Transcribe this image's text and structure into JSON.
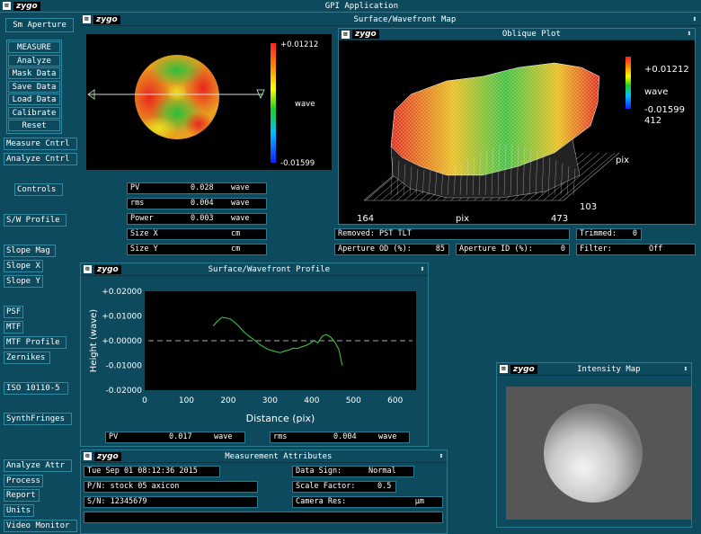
{
  "app": {
    "title": "GPI Application",
    "logo": "zygo"
  },
  "sidebar": {
    "aperture": "Sm Aperture",
    "group1": [
      "MEASURE",
      "Analyze",
      "Mask Data",
      "Save Data",
      "Load Data",
      "Calibrate",
      "Reset"
    ],
    "items": [
      "Measure Cntrl",
      "Analyze Cntrl",
      "Controls",
      "S/W Profile",
      "Slope Mag",
      "Slope X",
      "Slope Y",
      "PSF",
      "MTF",
      "MTF Profile",
      "Zernikes",
      "ISO 10110-5",
      "SynthFringes",
      "Analyze Attr",
      "Process",
      "Report",
      "Units",
      "Video Monitor"
    ]
  },
  "surface_map": {
    "title": "Surface/Wavefront Map",
    "scale_max": "+0.01212",
    "scale_mid": "wave",
    "scale_min": "-0.01599",
    "stats": [
      {
        "label": "PV",
        "value": "0.028",
        "unit": "wave"
      },
      {
        "label": "rms",
        "value": "0.004",
        "unit": "wave"
      },
      {
        "label": "Power",
        "value": "0.003",
        "unit": "wave"
      },
      {
        "label": "Size X",
        "value": "",
        "unit": "cm"
      },
      {
        "label": "Size Y",
        "value": "",
        "unit": "cm"
      }
    ]
  },
  "oblique": {
    "title": "Oblique Plot",
    "scale_max": "+0.01212",
    "scale_mid": "wave",
    "scale_min": "-0.01599",
    "z_val": "412",
    "pix_right": "pix",
    "y_val": "103",
    "x_min": "164",
    "x_label": "pix",
    "x_max": "473",
    "removed": "Removed: PST TLT",
    "trimmed_label": "Trimmed:",
    "trimmed_value": "0",
    "ap_od_label": "Aperture OD (%):",
    "ap_od_value": "85",
    "ap_id_label": "Aperture ID (%):",
    "ap_id_value": "0",
    "filter_label": "Filter:",
    "filter_value": "Off"
  },
  "profile": {
    "title": "Surface/Wavefront Profile",
    "pv_label": "PV",
    "pv_value": "0.017",
    "pv_unit": "wave",
    "rms_label": "rms",
    "rms_value": "0.004",
    "rms_unit": "wave"
  },
  "chart_data": {
    "type": "line",
    "xlabel": "Distance (pix)",
    "ylabel": "Height (wave)",
    "xlim": [
      0,
      650
    ],
    "ylim": [
      -0.02,
      0.02
    ],
    "xticks": [
      "0",
      "100",
      "200",
      "300",
      "400",
      "500",
      "600"
    ],
    "yticks": [
      "+0.02000",
      "+0.01000",
      "+0.00000",
      "-0.01000",
      "-0.02000"
    ],
    "series": [
      {
        "color": "#3fd23f",
        "x": [
          164,
          175,
          185,
          195,
          205,
          215,
          225,
          235,
          245,
          255,
          265,
          275,
          285,
          295,
          305,
          315,
          325,
          335,
          345,
          355,
          365,
          375,
          385,
          395,
          405,
          415,
          425,
          435,
          445,
          455,
          465,
          473
        ],
        "y": [
          0.006,
          0.008,
          0.0095,
          0.0092,
          0.0088,
          0.0075,
          0.006,
          0.004,
          0.0025,
          0.0012,
          0.0,
          -0.0015,
          -0.0025,
          -0.0035,
          -0.004,
          -0.0045,
          -0.0048,
          -0.0042,
          -0.0038,
          -0.003,
          -0.0032,
          -0.0025,
          -0.002,
          -0.0012,
          0.0,
          -0.0008,
          0.0018,
          0.0025,
          0.0015,
          -0.0005,
          -0.0035,
          -0.01
        ]
      }
    ]
  },
  "intensity": {
    "title": "Intensity Map"
  },
  "attributes": {
    "title": "Measurement Attributes",
    "date": "Tue Sep 01 08:12:36 2015",
    "pn": "P/N:  stock 05 axicon",
    "sn": "S/N:  12345679",
    "data_sign_label": "Data Sign:",
    "data_sign_value": "Normal",
    "scale_label": "Scale Factor:",
    "scale_value": "0.5",
    "camera_label": "Camera Res:",
    "camera_unit": "µm"
  }
}
